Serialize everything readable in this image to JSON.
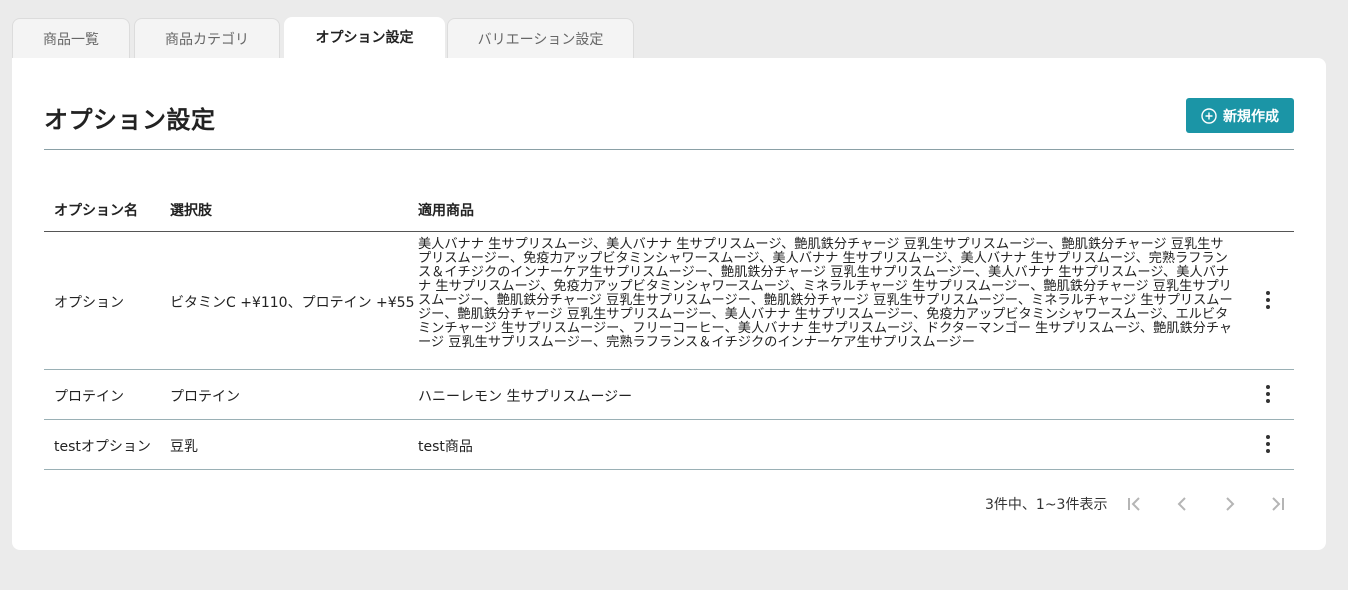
{
  "tabs": [
    {
      "label": "商品一覧",
      "active": false
    },
    {
      "label": "商品カテゴリ",
      "active": false
    },
    {
      "label": "オプション設定",
      "active": true
    },
    {
      "label": "バリエーション設定",
      "active": false
    }
  ],
  "header": {
    "title": "オプション設定",
    "new_button_label": "新規作成",
    "new_button_icon": "plus-circle-icon"
  },
  "colors": {
    "accent": "#1b95a6",
    "background": "#ebebeb",
    "panel": "#ffffff"
  },
  "table": {
    "columns": [
      "オプション名",
      "選択肢",
      "適用商品"
    ],
    "rows": [
      {
        "name": "オプション",
        "choices": "ビタミンC +¥110、プロテイン +¥55",
        "products": "美人バナナ 生サプリスムージ、美人バナナ 生サプリスムージ、艶肌鉄分チャージ 豆乳生サプリスムージー、艶肌鉄分チャージ 豆乳生サプリスムージー、免疫力アップビタミンシャワースムージ、美人バナナ 生サプリスムージ、美人バナナ 生サプリスムージ、完熟ラフランス＆イチジクのインナーケア生サプリスムージー、艶肌鉄分チャージ 豆乳生サプリスムージー、美人バナナ 生サプリスムージ、美人バナナ 生サプリスムージ、免疫力アップビタミンシャワースムージ、ミネラルチャージ 生サプリスムージー、艶肌鉄分チャージ 豆乳生サプリスムージー、艶肌鉄分チャージ 豆乳生サプリスムージー、艶肌鉄分チャージ 豆乳生サプリスムージー、ミネラルチャージ 生サプリスムージー、艶肌鉄分チャージ 豆乳生サプリスムージー、美人バナナ 生サプリスムージー、免疫力アップビタミンシャワースムージ、エルビタミンチャージ 生サプリスムージー、フリーコーヒー、美人バナナ 生サプリスムージ、ドクターマンゴー 生サプリスムージ、艶肌鉄分チャージ 豆乳生サプリスムージー、完熟ラフランス＆イチジクのインナーケア生サプリスムージー"
      },
      {
        "name": "プロテイン",
        "choices": "プロテイン",
        "products": "ハニーレモン 生サプリスムージー"
      },
      {
        "name": "testオプション",
        "choices": "豆乳",
        "products": "test商品"
      }
    ]
  },
  "pagination": {
    "summary": "3件中、1~3件表示",
    "first_icon": "first-page-icon",
    "prev_icon": "chevron-left-icon",
    "next_icon": "chevron-right-icon",
    "last_icon": "last-page-icon"
  }
}
